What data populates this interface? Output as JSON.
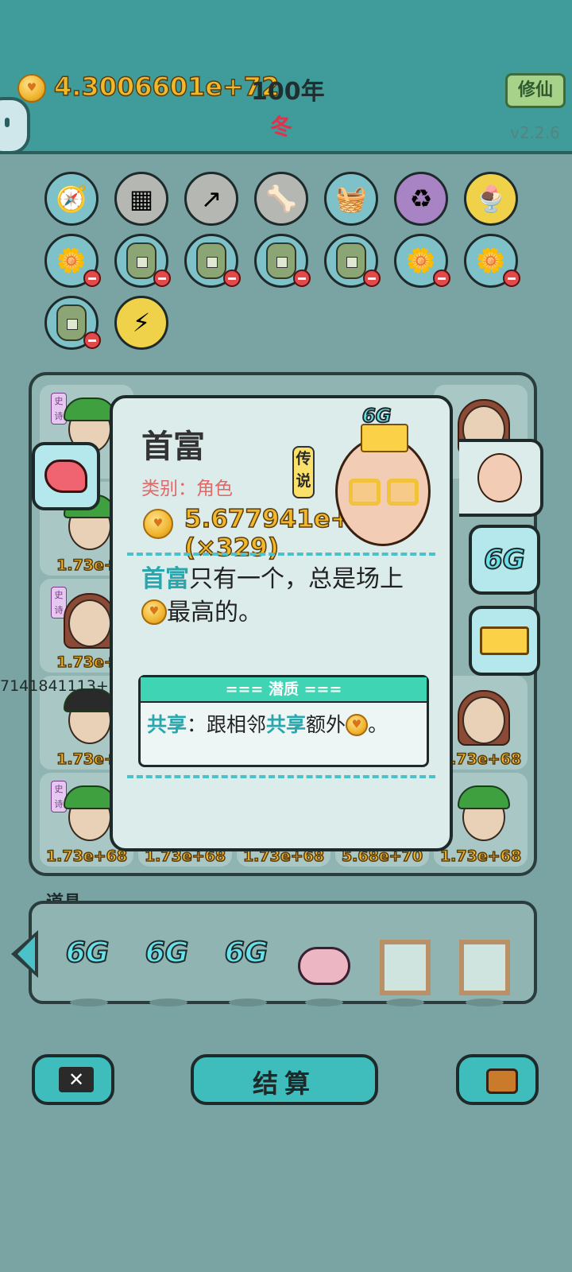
{
  "header": {
    "money": "4.3006601e+72",
    "year": "100年",
    "season": "冬",
    "xiuxian_button": "修仙",
    "version": "v2.2.6"
  },
  "popup": {
    "title": "首富",
    "category": "类别：角色",
    "rarity": "传说",
    "value": "5.677941e+70 (×329)",
    "desc_part1": "首富",
    "desc_part2": "只有一个，总是场上",
    "desc_part3": "最高的。",
    "trait_header": "=== 潜质 ===",
    "trait_word1": "共享",
    "trait_colon": "：跟相邻",
    "trait_word2": "共享",
    "trait_extra": "额外",
    "trait_end": "。",
    "portrait_badge": "6G"
  },
  "side_tabs": {
    "tab_6g": "6G"
  },
  "board": {
    "epic_tag": "史诗",
    "overflow_text": "7141841113+",
    "cells": [
      {
        "value": ""
      },
      {
        "value": "1.73e+"
      },
      {
        "value": "1.73e+"
      },
      {
        "value": "1.73e+"
      },
      {
        "value": "1.73e+68"
      },
      {
        "value": "1.73e+68"
      },
      {
        "value": "1.73e+68"
      },
      {
        "value": "1.73e+68"
      },
      {
        "value": "5.68e+70"
      },
      {
        "value": "1.73e+68"
      }
    ]
  },
  "items": {
    "title": "道具",
    "labels": [
      "6G",
      "6G",
      "6G"
    ]
  },
  "buttons": {
    "settle": "结算"
  },
  "colors": {
    "teal": "#3fbcbc",
    "gold": "#f2b82c",
    "red": "#e0324c"
  }
}
